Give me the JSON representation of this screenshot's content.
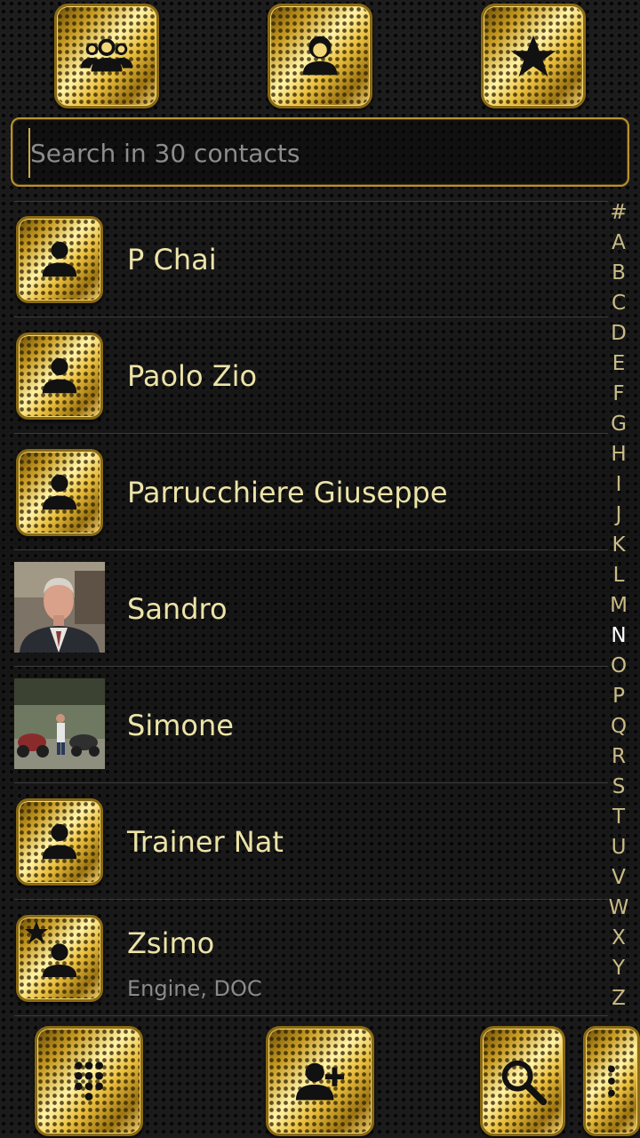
{
  "top_bar": {
    "groups_icon": "groups-icon",
    "contacts_icon": "contact-icon",
    "favorites_icon": "star-icon"
  },
  "search": {
    "placeholder": "Search in 30 contacts",
    "value": ""
  },
  "contacts": [
    {
      "name": "P Chai",
      "subtitle": "",
      "avatar": "default-person-icon"
    },
    {
      "name": "Paolo Zio",
      "subtitle": "",
      "avatar": "default-person-icon"
    },
    {
      "name": "Parrucchiere Giuseppe",
      "subtitle": "",
      "avatar": "default-person-icon"
    },
    {
      "name": "Sandro",
      "subtitle": "",
      "avatar": "photo"
    },
    {
      "name": "Simone",
      "subtitle": "",
      "avatar": "photo"
    },
    {
      "name": "Trainer Nat",
      "subtitle": "",
      "avatar": "default-person-icon"
    },
    {
      "name": "Zsimo",
      "subtitle": "Engine, DOC",
      "avatar": "default-person-icon",
      "favorite": true
    }
  ],
  "alphabet": [
    "#",
    "A",
    "B",
    "C",
    "D",
    "E",
    "F",
    "G",
    "H",
    "I",
    "J",
    "K",
    "L",
    "M",
    "N",
    "O",
    "P",
    "Q",
    "R",
    "S",
    "T",
    "U",
    "V",
    "W",
    "X",
    "Y",
    "Z"
  ],
  "alphabet_active": "N",
  "bottom_bar": {
    "dialpad_icon": "dialpad-icon",
    "add_contact_icon": "add-contact-icon",
    "search_icon": "search-icon",
    "menu_icon": "overflow-menu-icon"
  },
  "colors": {
    "gold": "#e8bd3c",
    "text": "#ece3a8",
    "subtitle": "#8a8a8a",
    "background": "#151515"
  }
}
